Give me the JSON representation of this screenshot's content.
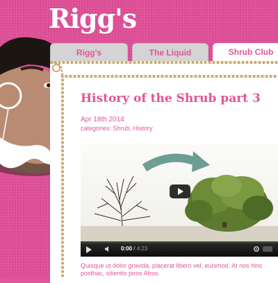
{
  "brand": {
    "logo": "Rigg's"
  },
  "tabs": [
    {
      "label": "Rigg's",
      "active": false
    },
    {
      "label": "The Liquid",
      "active": false
    },
    {
      "label": "Shrub Club",
      "active": true
    }
  ],
  "post": {
    "title": "History of the Shrub part 3",
    "date": "Apr 18th 2014",
    "categories_prefix": "categories: ",
    "categories": "Shrub, History",
    "body": "Quisque ut dolor gravida, placerat libero vel, euismod. At nos hinc posthac, sitientis piros Afros."
  },
  "video": {
    "current_time": "0:00",
    "separator": " / ",
    "duration": "4:23",
    "progress_fraction": 0.0
  },
  "colors": {
    "brand_pink": "#e2539b",
    "rope": "#c9a873",
    "arrow": "#6d9d93"
  }
}
